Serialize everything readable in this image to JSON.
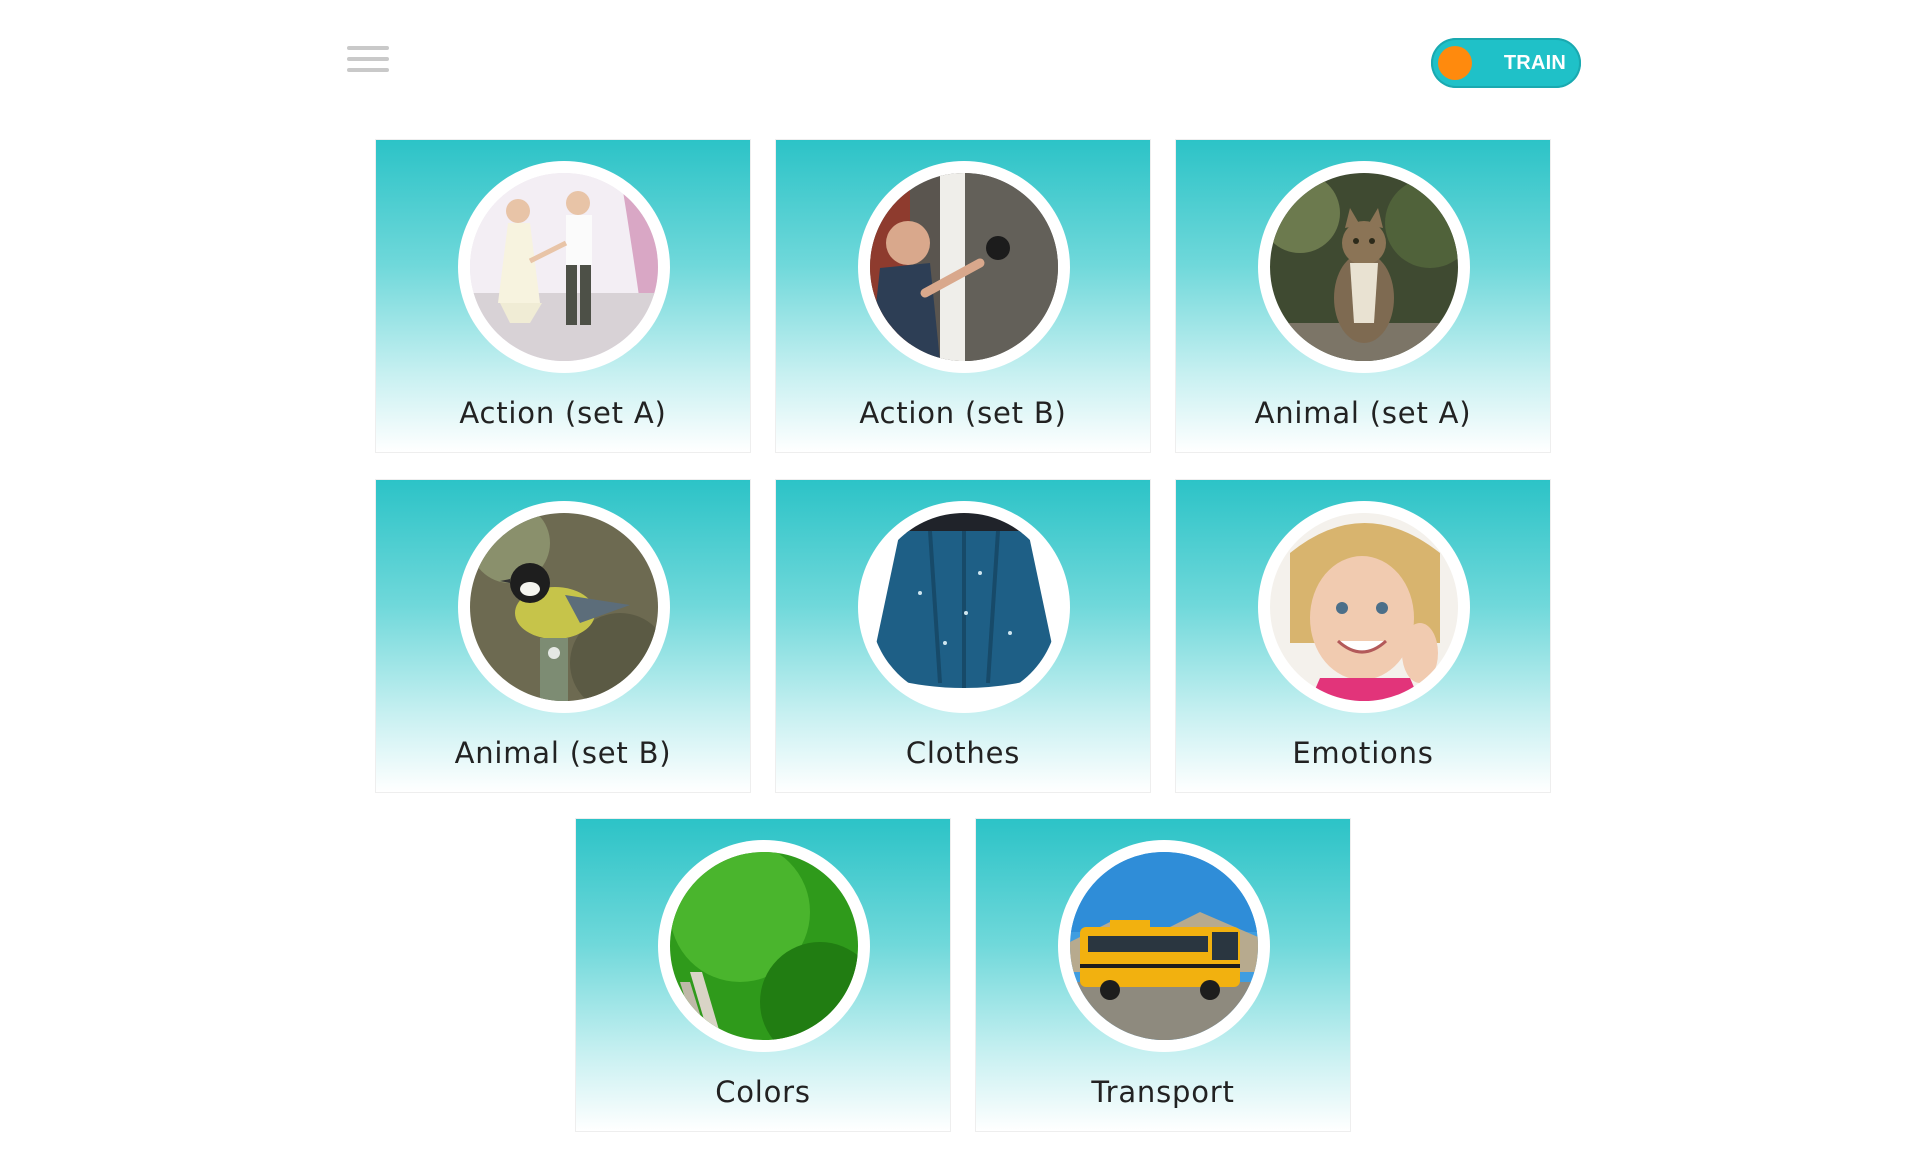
{
  "header": {
    "menu_icon": "hamburger-menu-icon",
    "mode_toggle": {
      "label": "TRAIN",
      "state": "on",
      "track_color": "#1fc1c8",
      "knob_color": "#ff8a0d"
    }
  },
  "categories": [
    {
      "label": "Action (set A)",
      "image": "children-dancing-photo"
    },
    {
      "label": "Action (set B)",
      "image": "child-opening-door-photo"
    },
    {
      "label": "Animal (set A)",
      "image": "cat-photo"
    },
    {
      "label": "Animal (set B)",
      "image": "bird-photo"
    },
    {
      "label": "Clothes",
      "image": "blue-skirt-photo"
    },
    {
      "label": "Emotions",
      "image": "smiling-girl-photo"
    },
    {
      "label": "Colors",
      "image": "green-wall-photo"
    },
    {
      "label": "Transport",
      "image": "school-bus-photo"
    }
  ],
  "theme": {
    "tile_gradient_top": "#2cc3c7",
    "tile_gradient_bottom": "#ffffff",
    "caption_color": "#222222"
  }
}
